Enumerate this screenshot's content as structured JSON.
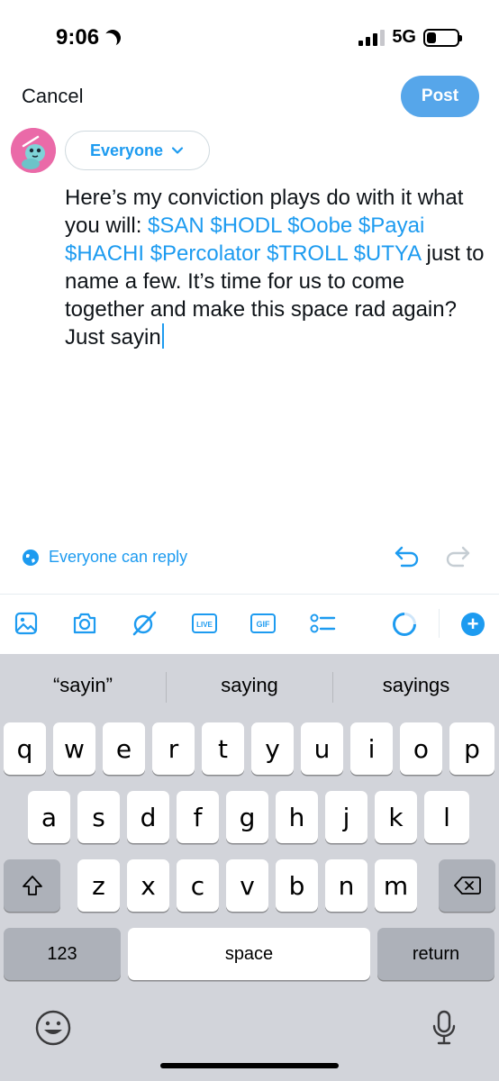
{
  "status_bar": {
    "time": "9:06",
    "network": "5G"
  },
  "header": {
    "cancel_label": "Cancel",
    "post_label": "Post"
  },
  "audience": {
    "label": "Everyone"
  },
  "compose": {
    "text_intro": "Here’s my conviction plays do with it what you will: ",
    "tickers": "$SAN $HODL $Oobe $Payai $HACHI $Percolator $TROLL $UTYA",
    "text_outro": " just to name a few. It’s time for us to come together and make this space rad again? Just sayin"
  },
  "reply_setting": {
    "label": "Everyone can reply"
  },
  "toolbar": {
    "icons": [
      "image-icon",
      "camera-icon",
      "grok-icon",
      "live-icon",
      "gif-icon",
      "poll-icon"
    ],
    "live_label": "LIVE",
    "gif_label": "GIF",
    "accent": "#1d9bf0"
  },
  "keyboard": {
    "suggestions": [
      "“sayin”",
      "saying",
      "sayings"
    ],
    "row1": [
      "q",
      "w",
      "e",
      "r",
      "t",
      "y",
      "u",
      "i",
      "o",
      "p"
    ],
    "row2": [
      "a",
      "s",
      "d",
      "f",
      "g",
      "h",
      "j",
      "k",
      "l"
    ],
    "row3": [
      "z",
      "x",
      "c",
      "v",
      "b",
      "n",
      "m"
    ],
    "numbers_label": "123",
    "space_label": "space",
    "return_label": "return"
  }
}
